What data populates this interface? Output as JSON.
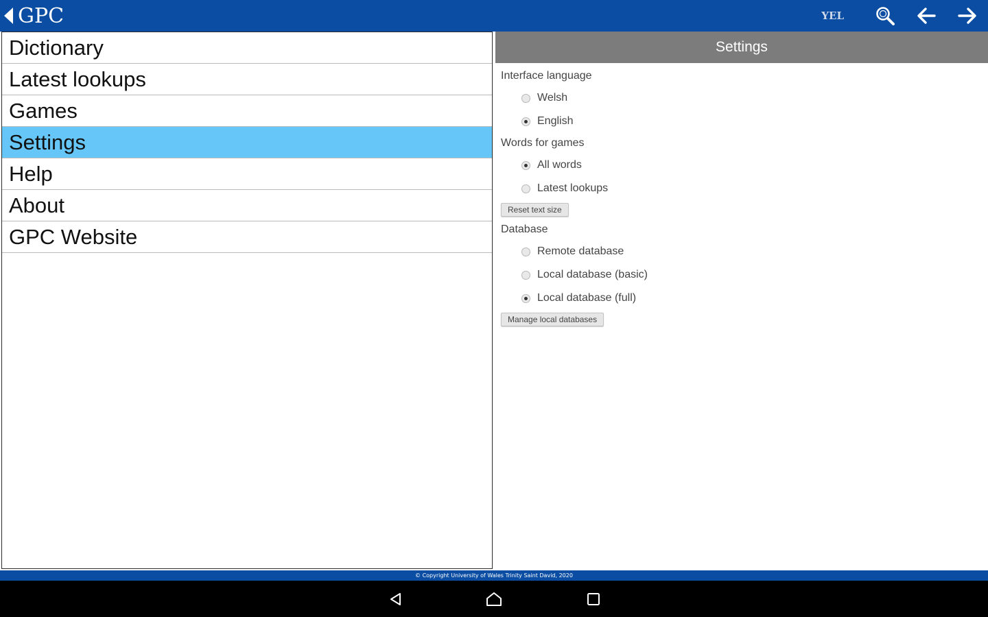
{
  "topbar": {
    "brand": "GPC",
    "lang_toggle": "YEL",
    "icons": [
      "back-triangle-icon",
      "search-icon",
      "arrow-left-icon",
      "arrow-right-icon"
    ],
    "color": "#0a4da2"
  },
  "menu": {
    "items": [
      {
        "label": "Dictionary"
      },
      {
        "label": "Latest lookups"
      },
      {
        "label": "Games"
      },
      {
        "label": "Settings",
        "active": true
      },
      {
        "label": "Help"
      },
      {
        "label": "About"
      },
      {
        "label": "GPC Website"
      }
    ],
    "active_color": "#65c6f7"
  },
  "settings": {
    "title": "Settings",
    "interface_language": {
      "label": "Interface language",
      "options": [
        {
          "label": "Welsh",
          "checked": false
        },
        {
          "label": "English",
          "checked": true
        }
      ]
    },
    "words_for_games": {
      "label": "Words for games",
      "options": [
        {
          "label": "All words",
          "checked": true
        },
        {
          "label": "Latest lookups",
          "checked": false
        }
      ]
    },
    "reset_button": "Reset text size",
    "database": {
      "label": "Database",
      "options": [
        {
          "label": "Remote database",
          "checked": false
        },
        {
          "label": "Local database (basic)",
          "checked": false
        },
        {
          "label": "Local database (full)",
          "checked": true
        }
      ]
    },
    "manage_button": "Manage local databases"
  },
  "footer": {
    "copyright": "© Copyright University of Wales Trinity Saint David, 2020"
  },
  "navbar": {
    "icons": [
      "back-icon",
      "home-icon",
      "recents-icon"
    ]
  }
}
